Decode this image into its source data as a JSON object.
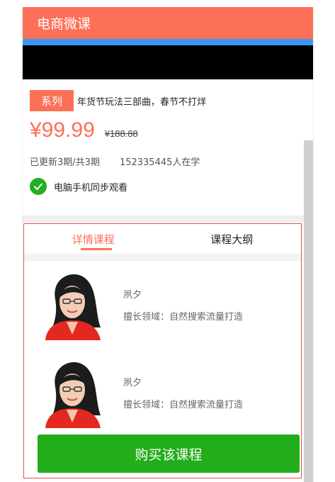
{
  "header": {
    "title": "电商微课"
  },
  "course": {
    "tag": "系列",
    "name": "年货节玩法三部曲，春节不打烊",
    "price": "¥99.99",
    "original_price": "¥188.88",
    "updates": "已更新3期/共3期",
    "learners": "152335445人在学",
    "sync_note": "电脑手机同步观看"
  },
  "tabs": [
    {
      "label": "详情课程",
      "active": true
    },
    {
      "label": "课程大纲",
      "active": false
    }
  ],
  "teachers": [
    {
      "name": "夙夕",
      "field": "擅长领域：自然搜索流量打造"
    },
    {
      "name": "夙夕",
      "field": "擅长领域：自然搜索流量打造"
    }
  ],
  "buy_label": "购买该课程",
  "colors": {
    "brand": "#fd7058",
    "buy": "#22ad1a",
    "check": "#22ad22",
    "strip": "#3b97f2"
  },
  "icons": {
    "sync": "check-circle-icon",
    "teacher": "portrait-photo"
  }
}
